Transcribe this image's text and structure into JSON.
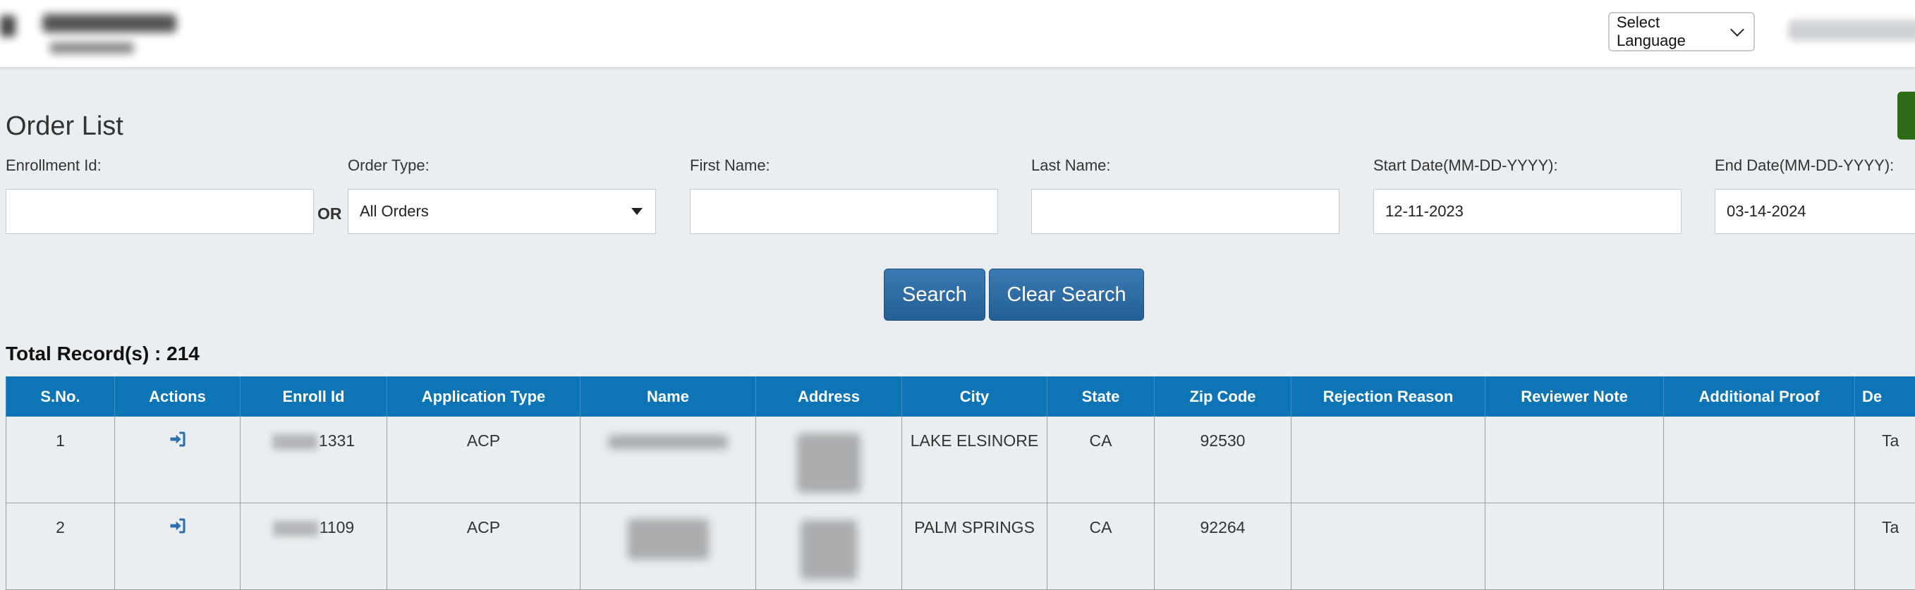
{
  "header": {
    "language_select": "Select Language"
  },
  "page": {
    "title": "Order List",
    "filters": {
      "enrollment_id_label": "Enrollment Id:",
      "enrollment_id_value": "",
      "or_label": "OR",
      "order_type_label": "Order Type:",
      "order_type_value": "All Orders",
      "first_name_label": "First Name:",
      "first_name_value": "",
      "last_name_label": "Last Name:",
      "last_name_value": "",
      "start_date_label": "Start Date(MM-DD-YYYY):",
      "start_date_value": "12-11-2023",
      "end_date_label": "End Date(MM-DD-YYYY):",
      "end_date_value": "03-14-2024"
    },
    "buttons": {
      "search": "Search",
      "clear_search": "Clear Search"
    },
    "total_label": "Total Record(s) : 214"
  },
  "table": {
    "columns": [
      "S.No.",
      "Actions",
      "Enroll Id",
      "Application Type",
      "Name",
      "Address",
      "City",
      "State",
      "Zip Code",
      "Rejection Reason",
      "Reviewer Note",
      "Additional Proof",
      "De"
    ],
    "rows": [
      {
        "sno": "1",
        "enroll_suffix": "1331",
        "app_type": "ACP",
        "city": "LAKE ELSINORE",
        "state": "CA",
        "zip": "92530",
        "rejection": "",
        "reviewer_note": "",
        "additional_proof": "",
        "last_partial": "Ta"
      },
      {
        "sno": "2",
        "enroll_suffix": "1109",
        "app_type": "ACP",
        "city": "PALM SPRINGS",
        "state": "CA",
        "zip": "92264",
        "rejection": "",
        "reviewer_note": "",
        "additional_proof": "",
        "last_partial": "Ta"
      }
    ]
  },
  "icons": {
    "action": "sign-in-arrow-icon",
    "dropdown": "chevron-down-icon"
  },
  "colors": {
    "header_blue": "#0d74b5",
    "button_blue": "#2d6aa3",
    "green_button": "#2e6b16",
    "background": "#ebeef0"
  }
}
